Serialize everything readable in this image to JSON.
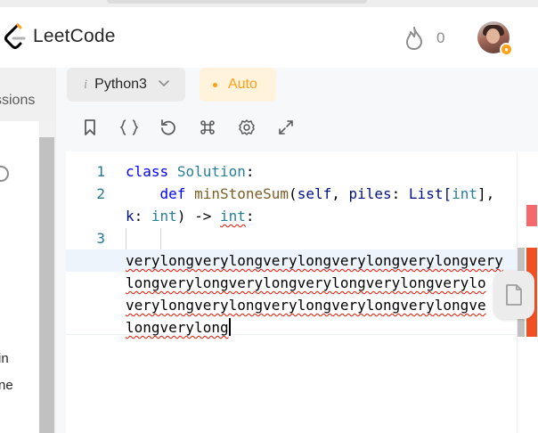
{
  "navbar": {
    "brand": "LeetCode",
    "streak_count": "0"
  },
  "left_panel": {
    "tab_label": "ssions",
    "text_fragment_1": "in",
    "text_fragment_2": "ne"
  },
  "toolbar": {
    "language": "Python3",
    "language_info_glyph": "i",
    "mode": "Auto",
    "icons": [
      "bookmark-icon",
      "braces-icon",
      "reset-icon",
      "command-icon",
      "settings-icon",
      "fullscreen-icon"
    ]
  },
  "editor": {
    "line_numbers": [
      "1",
      "2",
      "3"
    ],
    "line1": {
      "kw": "class",
      "name": "Solution",
      "tail": ":"
    },
    "line2a": {
      "kw": "def",
      "fn": "minStoneSum",
      "open": "(",
      "self": "self",
      "sep1": ", ",
      "param": "piles",
      "colon": ": ",
      "type": "List[",
      "inner": "int",
      "close": "],"
    },
    "line2b": {
      "param": "k",
      "colon": ": ",
      "type": "int",
      "arrow": ") -> ",
      "ret": "int",
      "tail": ":"
    },
    "wrapped_text": [
      "verylongverylongverylongverylongverylongvery",
      "longverylongverylongverylongverylongverylo",
      "verylongverylongverylongverylongverylongve",
      "longverylong"
    ]
  },
  "colors": {
    "brand_accent": "#ffa116",
    "keyword": "#0000ff",
    "type": "#267f99",
    "function": "#795e26",
    "line_number": "#237893",
    "error_squiggle": "#e51400"
  }
}
